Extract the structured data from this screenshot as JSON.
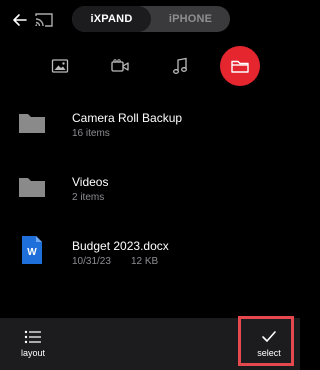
{
  "header": {
    "back_icon": "arrow-left-icon",
    "cast_icon": "cast-icon",
    "segments": [
      {
        "label": "iXPAND",
        "active": true
      },
      {
        "label": "iPHONE",
        "active": false
      }
    ]
  },
  "filters": [
    {
      "icon": "photo-icon",
      "active": false
    },
    {
      "icon": "video-icon",
      "active": false
    },
    {
      "icon": "music-icon",
      "active": false
    },
    {
      "icon": "folder-icon",
      "active": true
    }
  ],
  "files": [
    {
      "type": "folder",
      "name": "Camera Roll Backup",
      "meta": "16 items"
    },
    {
      "type": "folder",
      "name": "Videos",
      "meta": "2 items"
    },
    {
      "type": "word-doc",
      "name": "Budget 2023.docx",
      "date": "10/31/23",
      "size": "12 KB"
    }
  ],
  "bottom": {
    "layout_label": "layout",
    "select_label": "select"
  },
  "colors": {
    "accent": "#e5262f",
    "highlight": "#e5484d",
    "word_blue": "#1e6fd9",
    "folder_gray": "#8a8a8a"
  }
}
